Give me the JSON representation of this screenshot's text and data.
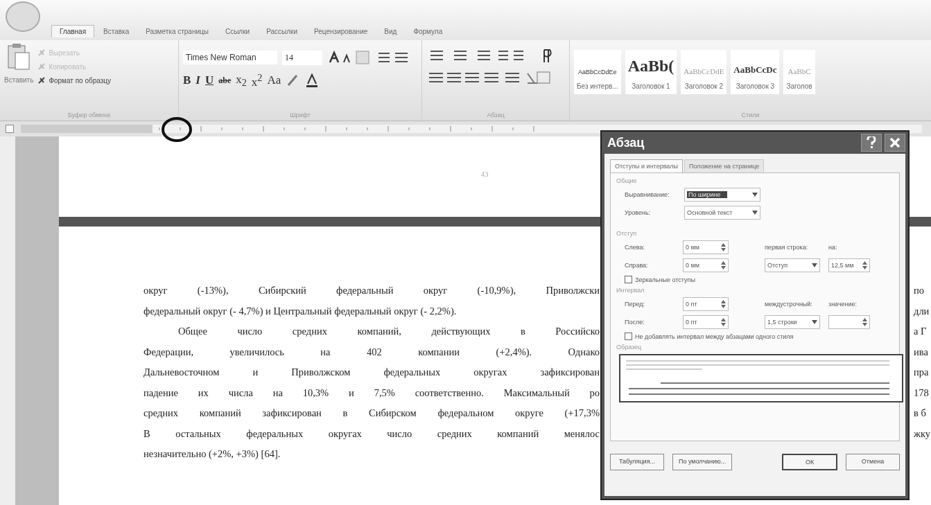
{
  "ribbon": {
    "tabs": [
      {
        "label": "Главная",
        "selected": true
      },
      {
        "label": "Вставка",
        "selected": false
      },
      {
        "label": "Разметка страницы",
        "selected": false
      },
      {
        "label": "Ссылки",
        "selected": false
      },
      {
        "label": "Рассылки",
        "selected": false
      },
      {
        "label": "Рецензирование",
        "selected": false
      },
      {
        "label": "Вид",
        "selected": false
      },
      {
        "label": "Формула",
        "selected": false
      }
    ],
    "clipboard": {
      "paste": "Вставить",
      "group": "Буфер обмена",
      "items": [
        {
          "label": "Вырезать",
          "disabled": true
        },
        {
          "label": "Копировать",
          "disabled": true
        },
        {
          "label": "Формат по образцу",
          "disabled": false
        }
      ]
    },
    "font": {
      "family": "Times New Roman",
      "size": "14",
      "group": "Шрифт",
      "format_buttons": [
        {
          "label": "B",
          "kind": "bold"
        },
        {
          "label": "I",
          "kind": "italic"
        },
        {
          "label": "U",
          "kind": "underline"
        },
        {
          "label": "abe",
          "kind": "strike"
        },
        {
          "label": "x$_{2}$",
          "kind": "plain"
        },
        {
          "label": "x$^{2}$",
          "kind": "plain"
        },
        {
          "label": "Aa",
          "kind": "plain"
        }
      ]
    },
    "paragraph": {
      "group": "Абзац"
    },
    "styles": {
      "group": "Стили",
      "items": [
        {
          "sample": "AaBbCcDdEe",
          "name": "Без интерв...",
          "kind": "small"
        },
        {
          "sample": "AaBb(",
          "name": "Заголовок 1",
          "kind": "large"
        },
        {
          "sample": "AaBbCcDdE",
          "name": "Заголовок 2",
          "kind": "light"
        },
        {
          "sample": "AaBbCcDc",
          "name": "Заголовок 3",
          "kind": "bold"
        },
        {
          "sample": "AaBbC",
          "name": "Заголов",
          "kind": "light"
        }
      ]
    }
  },
  "document": {
    "page_number": "43",
    "lines": [
      {
        "text": "округ (-13%), Сибирский федеральный округ (-10,9%), Приволжски",
        "kind": "justify"
      },
      {
        "text": "федеральный округ (- 4,7%) и Центральный федеральный округ (- 2,2%).",
        "kind": "last"
      },
      {
        "text": "Общее число средних компаний, действующих в Российско",
        "kind": "indent"
      },
      {
        "text": "Федерации, увеличилось на 402 компании (+2,4%). Однако",
        "kind": "justify"
      },
      {
        "text": "Дальневосточном и Приволжском федеральных округах зафиксирован",
        "kind": "justify"
      },
      {
        "text": "падение их числа на 10,3% и 7,5% соответственно. Максимальный ро",
        "kind": "justify"
      },
      {
        "text": "средних компаний зафиксирован в Сибирском федеральном округе (+17,3%",
        "kind": "justify"
      },
      {
        "text": "В остальных федеральных округах число средних компаний менялос",
        "kind": "justify"
      },
      {
        "text": "незначительно (+2%, +3%) [64].",
        "kind": "last"
      }
    ],
    "right_fragments": [
      "по",
      "дли",
      "а Г",
      "ива",
      "пра",
      "178",
      "в б",
      "жку"
    ]
  },
  "dialog": {
    "title": "Абзац",
    "tabs": [
      {
        "label": "Отступы и интервалы",
        "selected": true
      },
      {
        "label": "Положение на странице",
        "selected": false
      }
    ],
    "general": {
      "heading": "Общие",
      "alignment_label": "Выравнивание:",
      "alignment": "По ширине",
      "level_label": "Уровень:",
      "level": "Основной текст"
    },
    "indent": {
      "heading": "Отступ",
      "left_label": "Слева:",
      "left": "0 мм",
      "right_label": "Справа:",
      "right": "0 мм",
      "first_line_label": "первая строка:",
      "first_line": "Отступ",
      "by_label": "на:",
      "by": "12,5 мм",
      "mirror": {
        "label": "Зеркальные отступы",
        "checked": false
      }
    },
    "spacing": {
      "heading": "Интервал",
      "before_label": "Перед:",
      "before": "0 пт",
      "after_label": "После:",
      "after": "0 пт",
      "line_label": "междустрочный:",
      "line": "1,5 строки",
      "value_label": "значение:",
      "no_space": {
        "label": "Не добавлять интервал между абзацами одного стиля",
        "checked": false
      }
    },
    "preview": {
      "heading": "Образец"
    },
    "buttons": [
      "Табуляция...",
      "По умолчанию...",
      "ОК",
      "Отмена"
    ]
  }
}
